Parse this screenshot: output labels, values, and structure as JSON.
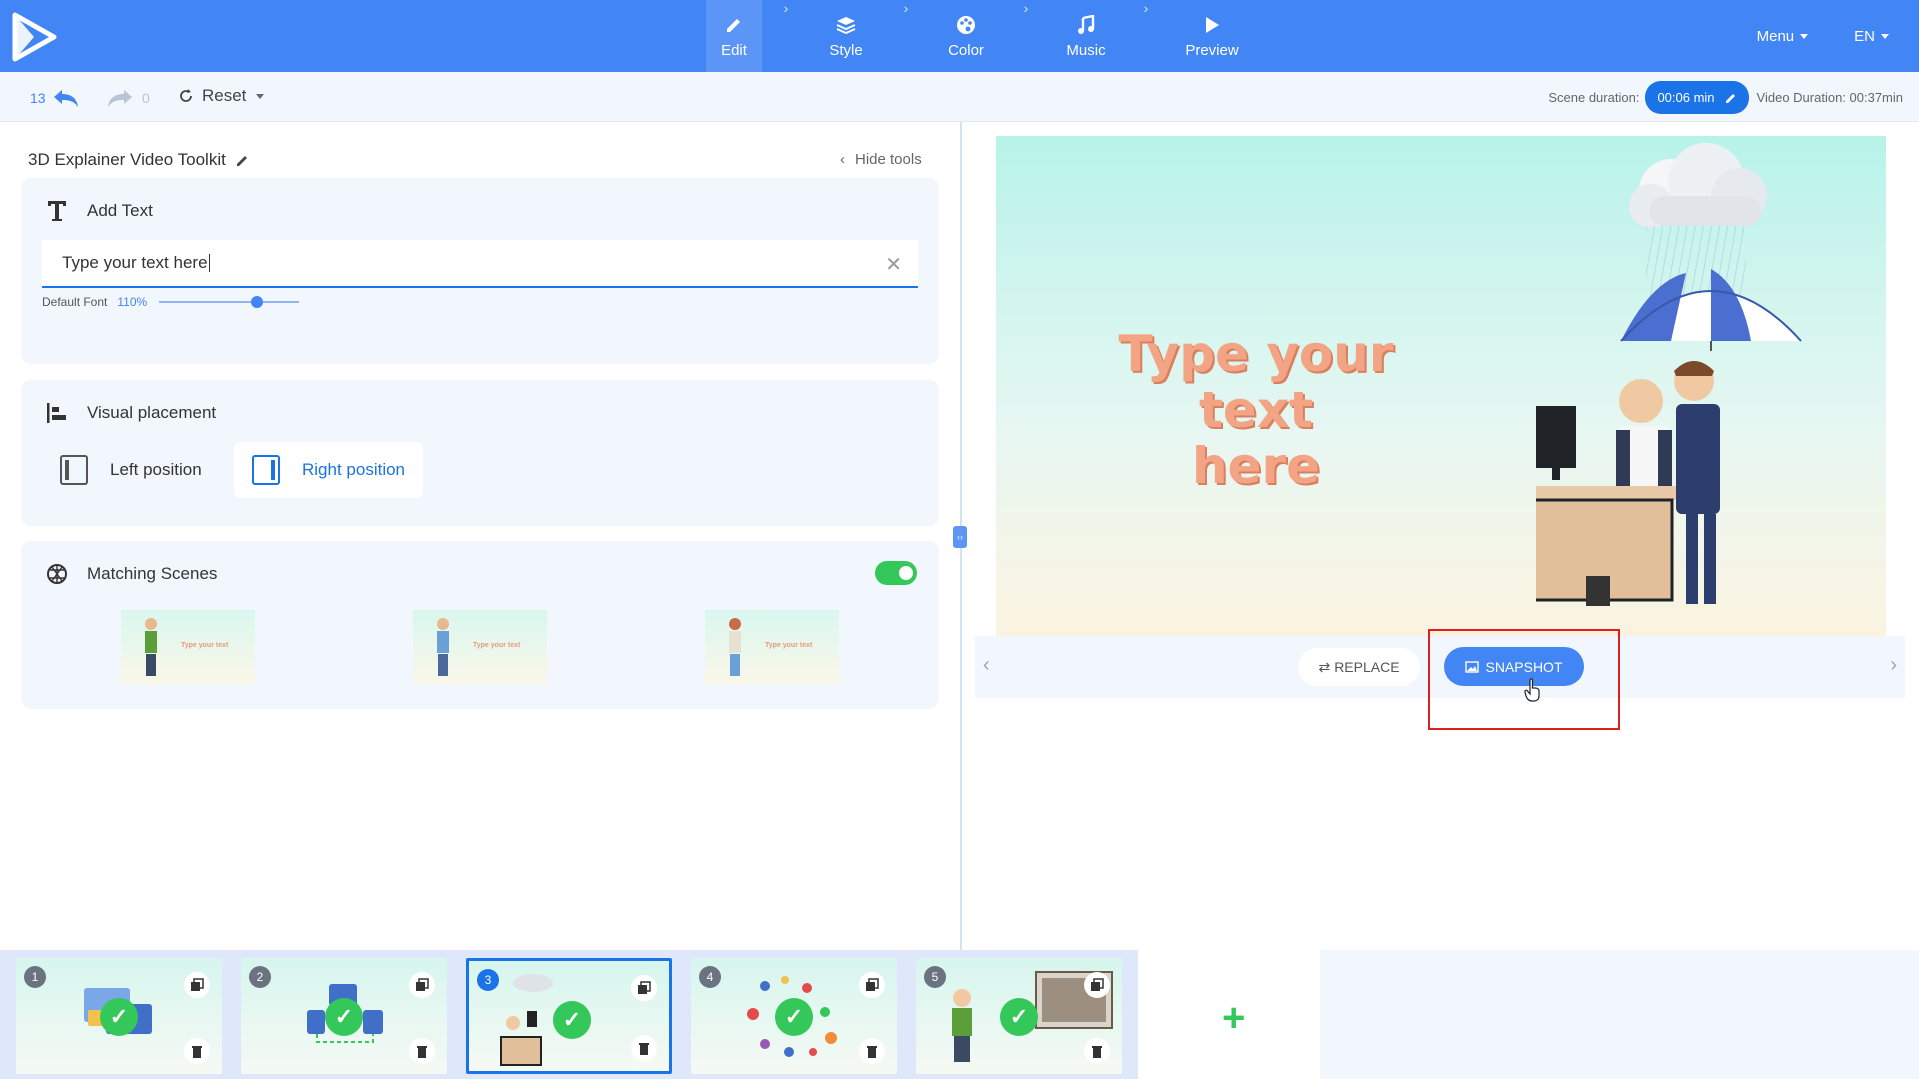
{
  "nav": {
    "steps": [
      {
        "label": "Edit",
        "icon": "pencil-icon"
      },
      {
        "label": "Style",
        "icon": "layers-icon"
      },
      {
        "label": "Color",
        "icon": "palette-icon"
      },
      {
        "label": "Music",
        "icon": "music-note-icon"
      },
      {
        "label": "Preview",
        "icon": "play-icon"
      }
    ],
    "menu_label": "Menu",
    "language": "EN"
  },
  "toolbar": {
    "undo_count": "13",
    "redo_count": "0",
    "reset_label": "Reset",
    "scene_duration_label": "Scene duration:",
    "scene_duration_value": "00:06 min",
    "video_duration": "Video Duration: 00:37min"
  },
  "left_panel": {
    "project_title": "3D Explainer Video Toolkit",
    "hide_tools": "Hide tools",
    "add_text": {
      "title": "Add Text",
      "input_value": "Type your text here",
      "font_label": "Default Font",
      "font_pct": "110%",
      "font_level_percent": 70
    },
    "placement": {
      "title": "Visual placement",
      "left": "Left position",
      "right": "Right position"
    },
    "matching": {
      "title": "Matching Scenes",
      "thumb_text": "Type your text",
      "enabled": true
    }
  },
  "preview": {
    "text_line1": "Type your text",
    "text_line2": "here",
    "replace": "REPLACE",
    "snapshot": "SNAPSHOT"
  },
  "timeline": {
    "scenes": [
      "1",
      "2",
      "3",
      "4",
      "5"
    ],
    "selected": "3"
  },
  "colors": {
    "primary": "#4285f4",
    "accent_blue": "#1a73e8",
    "success_green": "#34c759",
    "highlight_red": "#e02020",
    "preview_text": "#f2a485"
  }
}
